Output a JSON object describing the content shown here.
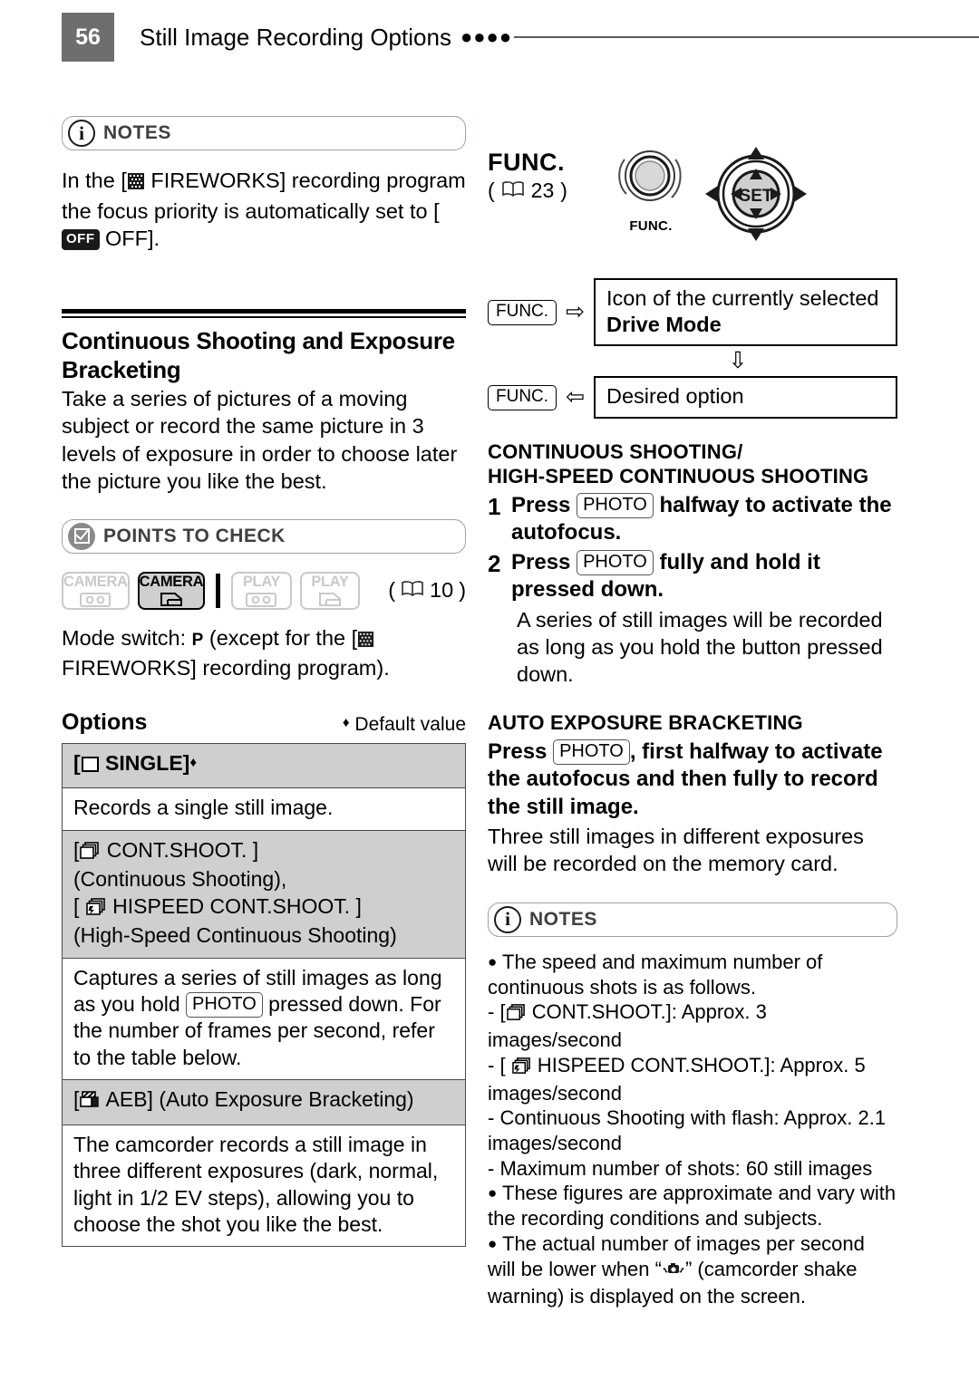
{
  "header": {
    "page_number": "56",
    "title": "Still Image Recording Options",
    "dots": "●●●●"
  },
  "left": {
    "notes": {
      "icon": "info-icon",
      "title": "NOTES",
      "body_pre": "In the [",
      "body_icon": "fireworks-icon",
      "body_mid": " FIREWORKS] recording program the focus priority is automatically set to [",
      "body_badge": "OFF",
      "body_post": " OFF]."
    },
    "section": {
      "heading": "Continuous Shooting and Exposure Bracketing",
      "intro": "Take a series of pictures of a moving subject or record the same picture in 3 levels of exposure in order to choose later the picture you like the best."
    },
    "points_to_check": {
      "icon": "checkbox-icon",
      "title": "POINTS TO CHECK",
      "modes": [
        {
          "name": "camera-tape",
          "label": "CAMERA",
          "media": "tape",
          "active": false
        },
        {
          "name": "camera-card",
          "label": "CAMERA",
          "media": "card",
          "active": true
        },
        {
          "name": "play-tape",
          "label": "PLAY",
          "media": "tape",
          "active": false
        },
        {
          "name": "play-card",
          "label": "PLAY",
          "media": "card",
          "active": false
        }
      ],
      "page_ref": "10",
      "mode_switch_pre": "Mode switch: ",
      "mode_switch_program": "P",
      "mode_switch_mid": " (except for the [",
      "mode_switch_post": "FIREWORKS] recording program)."
    },
    "options": {
      "title": "Options",
      "default_marker": "♦",
      "default_label": "Default value",
      "rows": [
        {
          "type": "head",
          "bold": true,
          "icon": "single-frame-icon",
          "text_pre": "[",
          "text": " SINGLE]",
          "marker": "♦"
        },
        {
          "type": "body",
          "text": "Records a single still image."
        },
        {
          "type": "head",
          "bold": false,
          "icon": "stacked-frames-icon",
          "line1_pre": "[",
          "line1": " CONT.SHOOT. ]",
          "line2": "(Continuous Shooting),",
          "icon2": "hispeed-stacked-frames-icon",
          "line3_pre": "[ ",
          "line3": " HISPEED CONT.SHOOT. ]",
          "line4": "(High-Speed Continuous Shooting)"
        },
        {
          "type": "body",
          "text_a": "Captures a series of still images as long as you hold ",
          "key": "PHOTO",
          "text_b": " pressed down. For the number of frames per second, refer to the table below."
        },
        {
          "type": "head",
          "bold": false,
          "icon": "aeb-icon",
          "text_pre": "[",
          "text": " AEB] (Auto Exposure Bracketing)"
        },
        {
          "type": "body",
          "text": "The camcorder records a still image in three different exposures (dark, normal, light in 1/2 EV steps), allowing you to choose the shot you like the best."
        }
      ]
    }
  },
  "right": {
    "func": {
      "word": "FUNC.",
      "page_ref": "23",
      "button_caption": "FUNC.",
      "joystick_center": "SET"
    },
    "flow": {
      "step1_key": "FUNC.",
      "step1_arrow": "⇨",
      "step1_line1": "Icon of the currently selected",
      "step1_line2": "Drive Mode",
      "down_arrow": "⇩",
      "step2_key": "FUNC.",
      "step2_arrow": "⇦",
      "step2_text": "Desired option"
    },
    "continuous": {
      "heading_line1": "CONTINUOUS SHOOTING/",
      "heading_line2": "HIGH-SPEED CONTINUOUS SHOOTING",
      "steps": [
        {
          "num": "1",
          "text_a": "Press ",
          "key": "PHOTO",
          "text_b": " halfway to activate the autofocus."
        },
        {
          "num": "2",
          "text_a": "Press ",
          "key": "PHOTO",
          "text_b": " fully and hold it pressed down.",
          "sub": "A series of still images will be recorded as long as you hold the button pressed down."
        }
      ]
    },
    "aeb": {
      "heading": "AUTO EXPOSURE BRACKETING",
      "press_a": "Press ",
      "key": "PHOTO",
      "press_b": ", first halfway to activate the autofocus and then fully to record the still image.",
      "after": "Three still images in different exposures will be recorded on the memory card."
    },
    "notes": {
      "icon": "info-icon",
      "title": "NOTES",
      "items": [
        {
          "marker": "●",
          "text": "The speed and maximum number of continuous shots is as follows."
        },
        {
          "marker": "-",
          "icon": "stacked-frames-icon",
          "text_pre": "[",
          "text": " CONT.SHOOT.]: Approx. 3 images/second"
        },
        {
          "marker": "-",
          "icon": "hispeed-stacked-frames-icon",
          "text_pre": "[ ",
          "text": " HISPEED CONT.SHOOT.]: Approx. 5 images/second"
        },
        {
          "marker": "-",
          "text": "Continuous Shooting with flash: Approx. 2.1 images/second"
        },
        {
          "marker": "-",
          "text": "Maximum number of shots: 60 still images"
        },
        {
          "marker": "●",
          "text": "These figures are approximate and vary with the recording conditions and subjects."
        },
        {
          "marker": "●",
          "text_pre": "The actual number of images per second will be lower when “",
          "icon": "camera-shake-icon",
          "text_post": "” (camcorder shake warning) is displayed on the screen."
        }
      ]
    }
  }
}
